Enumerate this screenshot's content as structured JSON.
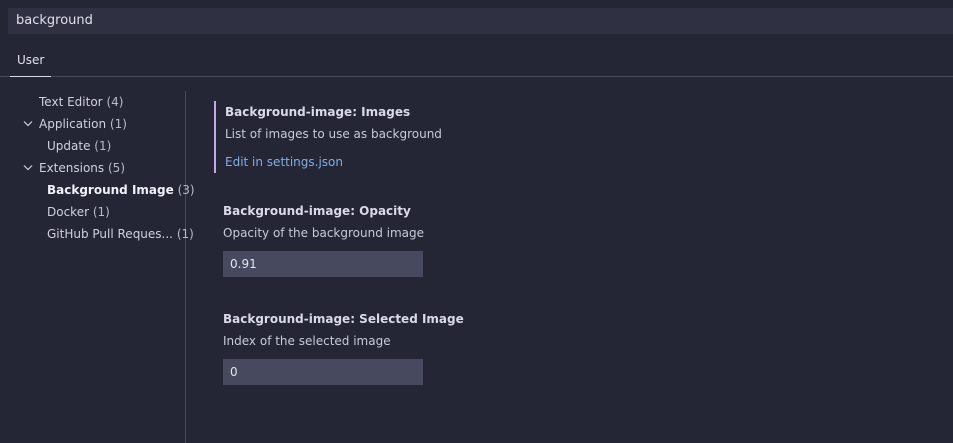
{
  "search": {
    "value": "background"
  },
  "tabs": [
    {
      "label": "User"
    }
  ],
  "toc": {
    "items": [
      {
        "label": "Text Editor",
        "count": "(4)"
      },
      {
        "label": "Application",
        "count": "(1)"
      },
      {
        "label": "Update",
        "count": "(1)"
      },
      {
        "label": "Extensions",
        "count": "(5)"
      },
      {
        "label": "Background Image",
        "count": "(3)"
      },
      {
        "label": "Docker",
        "count": "(1)"
      },
      {
        "label": "GitHub Pull Reques...",
        "count": "(1)"
      }
    ]
  },
  "settings": [
    {
      "category": "Background-image: ",
      "name": "Images",
      "description": "List of images to use as background",
      "link": "Edit in settings.json"
    },
    {
      "category": "Background-image: ",
      "name": "Opacity",
      "description": "Opacity of the background image",
      "value": "0.91"
    },
    {
      "category": "Background-image: ",
      "name": "Selected Image",
      "description": "Index of the selected image",
      "value": "0"
    }
  ],
  "colors": {
    "background": "#242535",
    "focus_border": "#c7a7ea",
    "link": "#7fb0e8",
    "input_bg": "#474a5e"
  }
}
